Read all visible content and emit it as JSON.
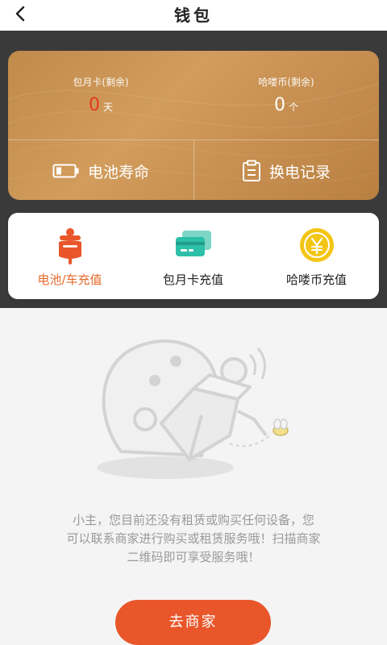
{
  "header": {
    "title": "钱包",
    "back_icon": "chevron-left-icon"
  },
  "card": {
    "monthly_card": {
      "label": "包月卡(剩余)",
      "value": "0",
      "unit": "天",
      "value_color": "#e43a1e"
    },
    "halou_coin": {
      "label": "哈喽币(剩余)",
      "value": "0",
      "unit": "个"
    },
    "battery_life": {
      "label": "电池寿命",
      "icon": "battery-icon"
    },
    "swap_records": {
      "label": "换电记录",
      "icon": "clipboard-icon"
    }
  },
  "actions": [
    {
      "label": "电池/车充值",
      "icon": "scooter-icon",
      "active": true
    },
    {
      "label": "包月卡充值",
      "icon": "card-icon"
    },
    {
      "label": "哈喽币充值",
      "icon": "yuan-coin-icon"
    }
  ],
  "empty": {
    "line1": "小主，您目前还没有租赁或购买任何设备，您",
    "line2": "可以联系商家进行购买或租赁服务哦！扫描商家",
    "line3": "二维码即可享受服务哦！"
  },
  "cta": {
    "label": "去商家"
  },
  "colors": {
    "accent": "#e8562a",
    "card_gold": "#c99152",
    "active_tab": "#e76a2a",
    "teal_icon": "#2dbfa8",
    "coin_yellow": "#f3c514"
  }
}
